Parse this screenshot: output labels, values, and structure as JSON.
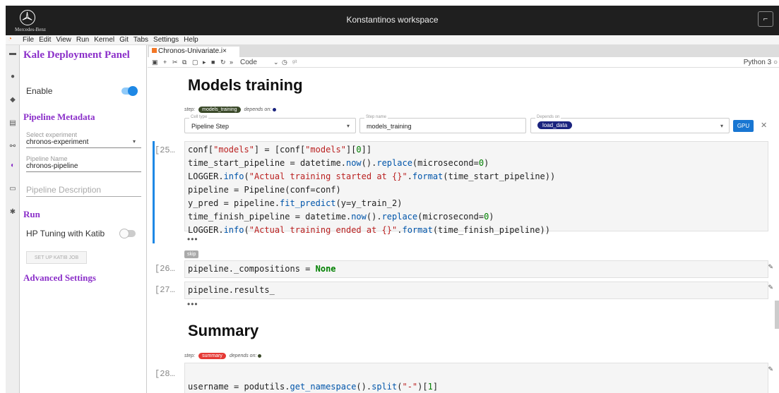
{
  "window": {
    "brand": "Mercedes-Benz",
    "title": "Konstantinos workspace"
  },
  "menu": {
    "items": [
      "File",
      "Edit",
      "View",
      "Run",
      "Kernel",
      "Git",
      "Tabs",
      "Settings",
      "Help"
    ]
  },
  "kale": {
    "title": "Kale Deployment Panel",
    "enable_label": "Enable",
    "enable_on": true,
    "metadata_title": "Pipeline Metadata",
    "experiment_label": "Select experiment",
    "experiment_value": "chronos-experiment",
    "pipeline_name_label": "Pipeline Name",
    "pipeline_name_value": "chronos-pipeline",
    "pipeline_desc_placeholder": "Pipeline Description",
    "run_title": "Run",
    "hp_label": "HP Tuning with Katib",
    "hp_on": false,
    "katib_button": "SET UP KATIB JOB",
    "advanced_title": "Advanced Settings",
    "accent": "#8b2fc9"
  },
  "notebook": {
    "tab_name": "Chronos-Univariate.i",
    "tab_close": "×",
    "cell_mode": "Code",
    "git_label": "git",
    "kernel": "Python 3",
    "headings": {
      "training": "Models training",
      "summary": "Summary"
    },
    "training_step": {
      "step_label": "step:",
      "name": "models_training",
      "depends_label": "depends on:",
      "color": "#3b4a2a",
      "dot_color": "#1a237e"
    },
    "training_meta": {
      "cell_type_label": "Cell type",
      "cell_type_value": "Pipeline Step",
      "step_name_label": "Step name",
      "step_name_value": "models_training",
      "depends_label": "Depends on",
      "depends_value": "load_data",
      "gpu": "GPU"
    },
    "cell25": {
      "prompt": "[25…"
    },
    "cell26": {
      "prompt": "[26…",
      "tag": "skip"
    },
    "cell27": {
      "prompt": "[27…"
    },
    "summary_step": {
      "step_label": "step:",
      "name": "summary",
      "depends_label": "depends on:",
      "color": "#e53935",
      "dot_color": "#3b4a2a"
    },
    "cell28": {
      "prompt": "[28…"
    },
    "ellipsis": "•••"
  }
}
